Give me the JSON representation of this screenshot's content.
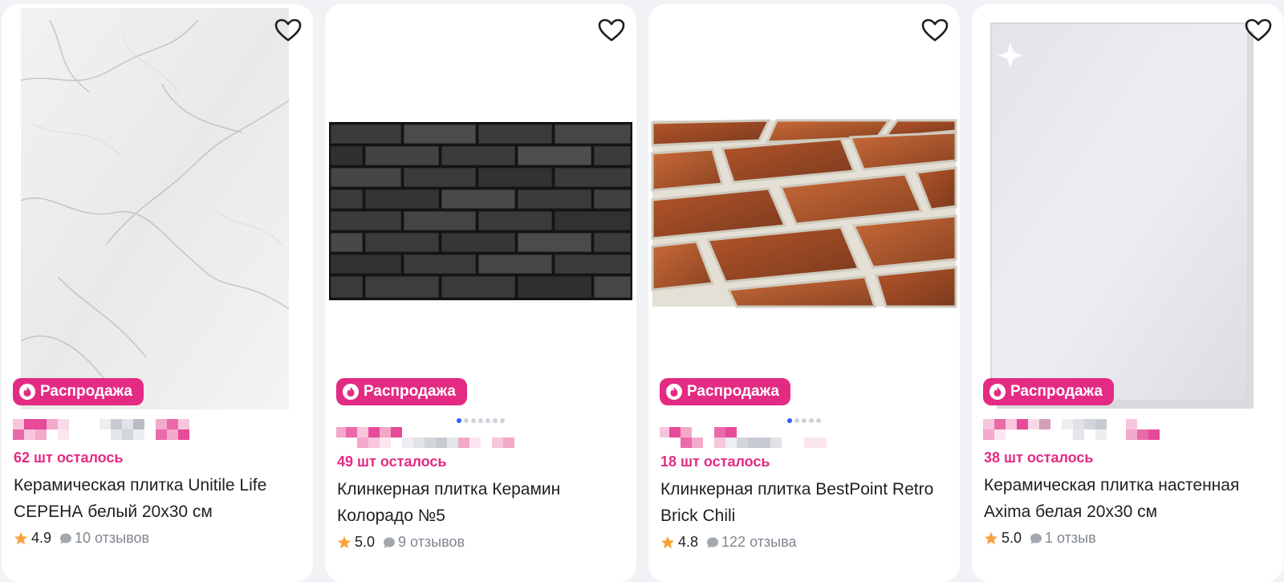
{
  "colors": {
    "accent": "#e32b83",
    "star": "#f7a33a",
    "muted": "#808590",
    "dot_active": "#2962ff"
  },
  "icons": {
    "favorite": "heart-outline-icon",
    "badge": "flame-icon",
    "rating": "star-icon",
    "reviews": "speech-bubble-icon"
  },
  "products": [
    {
      "badge": "Распродажа",
      "stock_count": "62",
      "stock_text": "шт осталось",
      "title": "Керамическая плитка Unitile Life СЕРЕНА белый 20x30 см",
      "rating": "4.9",
      "reviews": "10 отзывов",
      "image": "white-marble-tile",
      "has_dots": false
    },
    {
      "badge": "Распродажа",
      "stock_count": "49",
      "stock_text": "шт осталось",
      "title": "Клинкерная плитка Керамин Колорадо №5",
      "rating": "5.0",
      "reviews": "9 отзывов",
      "image": "black-brick-tile",
      "has_dots": true,
      "dots_total": 7,
      "dots_active": 1
    },
    {
      "badge": "Распродажа",
      "stock_count": "18",
      "stock_text": "шт осталось",
      "title": "Клинкерная плитка BestPoint Retro Brick Chili",
      "rating": "4.8",
      "reviews": "122 отзыва",
      "image": "red-brick-tile",
      "has_dots": true,
      "dots_total": 5,
      "dots_active": 1
    },
    {
      "badge": "Распродажа",
      "stock_count": "38",
      "stock_text": "шт осталось",
      "title": "Керамическая плитка настенная Axima белая 20x30 см",
      "rating": "5.0",
      "reviews": "1 отзыв",
      "image": "white-glossy-tile",
      "has_dots": false
    }
  ]
}
